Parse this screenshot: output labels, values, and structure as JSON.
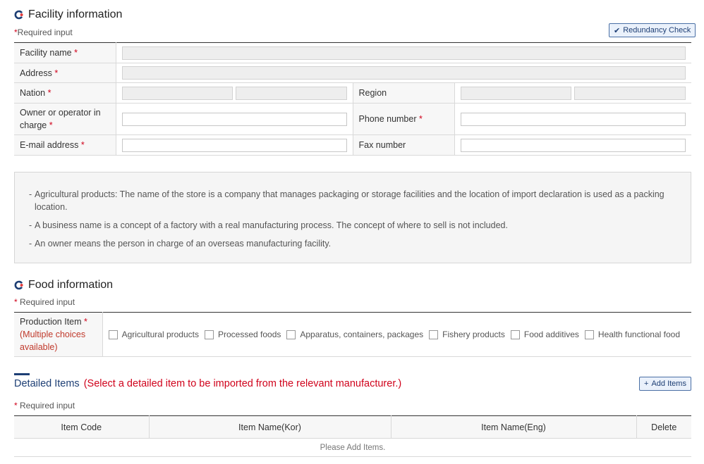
{
  "facility": {
    "title": "Facility information",
    "required_note": "Required input",
    "redundancy_button": "Redundancy Check",
    "fields": {
      "facility_name": "Facility name",
      "address": "Address",
      "nation": "Nation",
      "region": "Region",
      "owner": "Owner or operator in charge",
      "phone": "Phone number",
      "email": "E-mail address",
      "fax": "Fax number"
    }
  },
  "notice": {
    "items": [
      "Agricultural products: The name of the store is a company that manages packaging or storage facilities and the location of import declaration is used as a packing location.",
      "A business name is a concept of a factory with a real manufacturing process. The concept of where to sell is not included.",
      "An owner means the person in charge of an overseas manufacturing facility."
    ]
  },
  "food": {
    "title": "Food information",
    "required_note": "Required input",
    "production_label": "Production Item",
    "production_sub": "(Multiple choices available)",
    "options": [
      "Agricultural products",
      "Processed foods",
      "Apparatus, containers, packages",
      "Fishery products",
      "Food additives",
      "Health functional food"
    ]
  },
  "detailed": {
    "title": "Detailed Items",
    "instruction": "(Select a detailed item to be imported from the relevant manufacturer.)",
    "add_button": "Add Items",
    "required_note": "Required input",
    "columns": [
      "Item Code",
      "Item Name(Kor)",
      "Item Name(Eng)",
      "Delete"
    ],
    "empty": "Please Add Items."
  },
  "colors": {
    "accent": "#1d3e74",
    "required": "#d0021b"
  }
}
